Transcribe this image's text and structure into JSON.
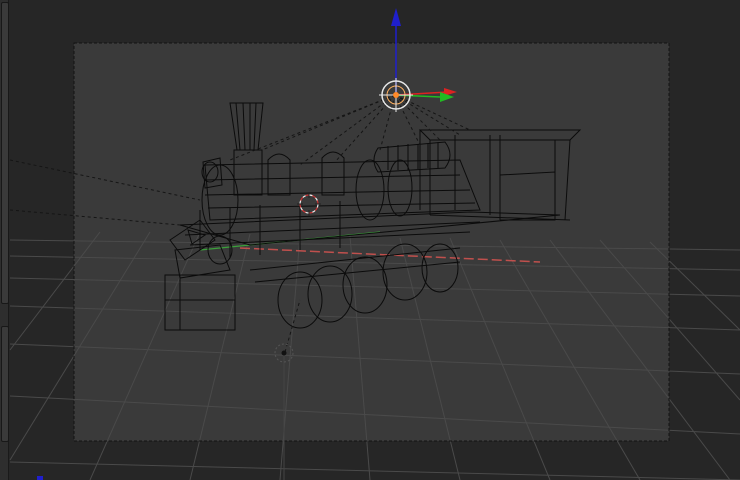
{
  "app": {
    "view": "camera-viewport",
    "shading": "wireframe",
    "active_object": "locomotive"
  },
  "colors": {
    "background": "#262626",
    "camera_region": "#3a3a3a",
    "grid": "#4a4a4a",
    "wire": "#0b0b0b",
    "axis_x": "#c0504d",
    "axis_y": "#3aa03a",
    "gizmo_z": "#1f1fcc",
    "gizmo_x": "#dd2222",
    "gizmo_y": "#22bb22",
    "lamp_ring": "#e8e8e8",
    "lamp_dot": "#ff8a2a",
    "cursor_red": "#cc3333"
  },
  "icons": {
    "gizmo": "transform-gizmo-icon",
    "lamp": "lamp-icon",
    "cursor": "3d-cursor-icon",
    "origin": "object-origin-icon"
  }
}
